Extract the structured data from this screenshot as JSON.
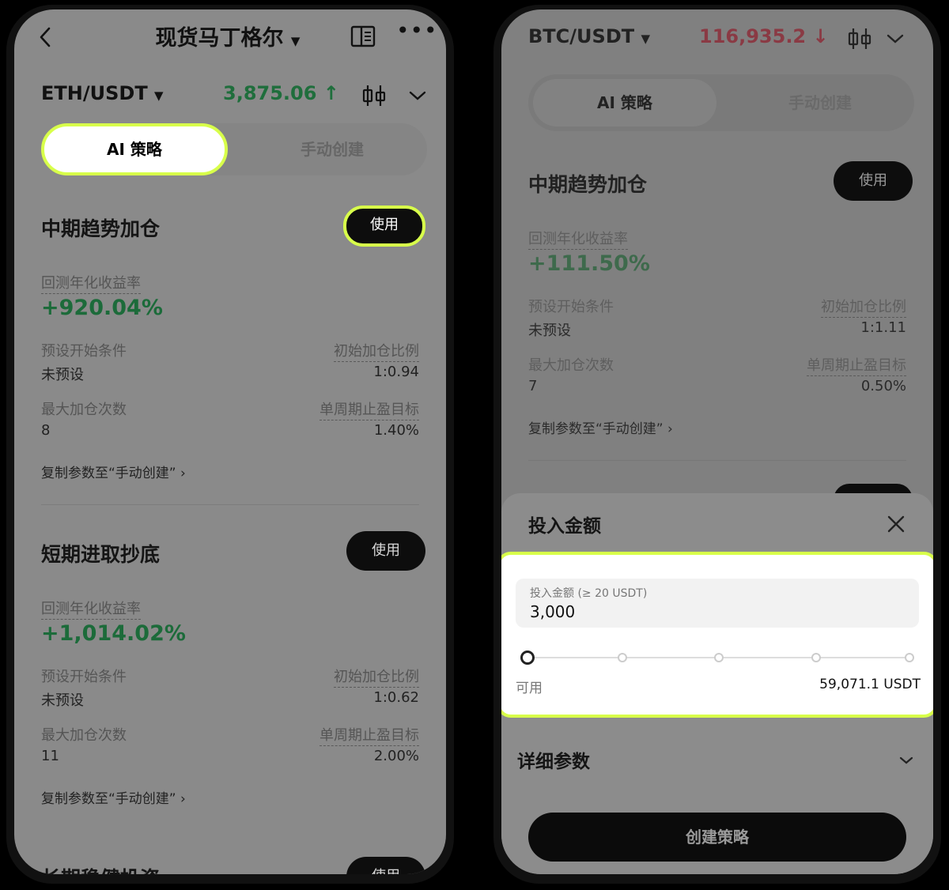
{
  "left": {
    "nav_title": "现货马丁格尔",
    "pair": "ETH/USDT",
    "price": "3,875.06",
    "tabs": {
      "ai": "AI 策略",
      "manual": "手动创建"
    },
    "cards": [
      {
        "title": "中期趋势加仓",
        "use": "使用",
        "yield_label": "回测年化收益率",
        "yield_value": "+920.04%",
        "start_label": "预设开始条件",
        "start_value": "未预设",
        "ratio_label": "初始加仓比例",
        "ratio_value": "1:0.94",
        "max_label": "最大加仓次数",
        "max_value": "8",
        "tp_label": "单周期止盈目标",
        "tp_value": "1.40%",
        "copy": "复制参数至“手动创建”"
      },
      {
        "title": "短期进取抄底",
        "use": "使用",
        "yield_label": "回测年化收益率",
        "yield_value": "+1,014.02%",
        "start_label": "预设开始条件",
        "start_value": "未预设",
        "ratio_label": "初始加仓比例",
        "ratio_value": "1:0.62",
        "max_label": "最大加仓次数",
        "max_value": "11",
        "tp_label": "单周期止盈目标",
        "tp_value": "2.00%",
        "copy": "复制参数至“手动创建”"
      },
      {
        "title": "长期稳健投资",
        "use": "使用"
      }
    ]
  },
  "right": {
    "pair": "BTC/USDT",
    "price": "116,935.2",
    "tabs": {
      "ai": "AI 策略",
      "manual": "手动创建"
    },
    "card": {
      "title": "中期趋势加仓",
      "use": "使用",
      "yield_label": "回测年化收益率",
      "yield_value": "+111.50%",
      "start_label": "预设开始条件",
      "start_value": "未预设",
      "ratio_label": "初始加仓比例",
      "ratio_value": "1:1.11",
      "max_label": "最大加仓次数",
      "max_value": "7",
      "tp_label": "单周期止盈目标",
      "tp_value": "0.50%",
      "copy": "复制参数至“手动创建”"
    },
    "sheet": {
      "title": "投入金额",
      "field_placeholder": "投入金额 (≥ 20 USDT)",
      "field_value": "3,000",
      "available_label": "可用",
      "available_value": "59,071.1 USDT",
      "slider_percent": 0,
      "details_title": "详细参数",
      "create_button": "创建策略"
    }
  },
  "colors": {
    "highlight": "#d8ff4a",
    "green": "#1c6b3a",
    "red": "#8a3a44"
  },
  "icons": [
    "back-icon",
    "book-icon",
    "more-icon",
    "candlestick-icon",
    "chevron-down-icon",
    "close-icon",
    "arrow-up-icon",
    "arrow-down-icon",
    "chevron-right-icon"
  ]
}
